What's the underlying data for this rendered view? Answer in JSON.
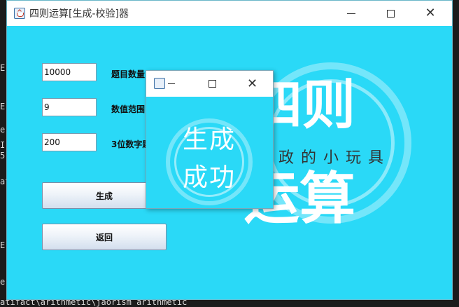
{
  "window": {
    "title": "四则运算[生成-校验]器"
  },
  "form": {
    "count_value": "10000",
    "count_label": "题目数量",
    "range_value": "9",
    "range_label": "数值范围",
    "digits_value": "200",
    "digits_label": "3位数字题"
  },
  "buttons": {
    "generate": "生成",
    "back": "返回"
  },
  "logo": {
    "line1": "四则",
    "line2": "运算",
    "tagline": "政的小玩具"
  },
  "dialog": {
    "message_line1": "生成",
    "message_line2": "成功"
  },
  "console": {
    "frags": [
      "E",
      "E",
      "e",
      "I",
      "5",
      "at",
      "E",
      "e"
    ],
    "bottom": "atifact\\arithmetic\\jaorism arithmetic"
  }
}
